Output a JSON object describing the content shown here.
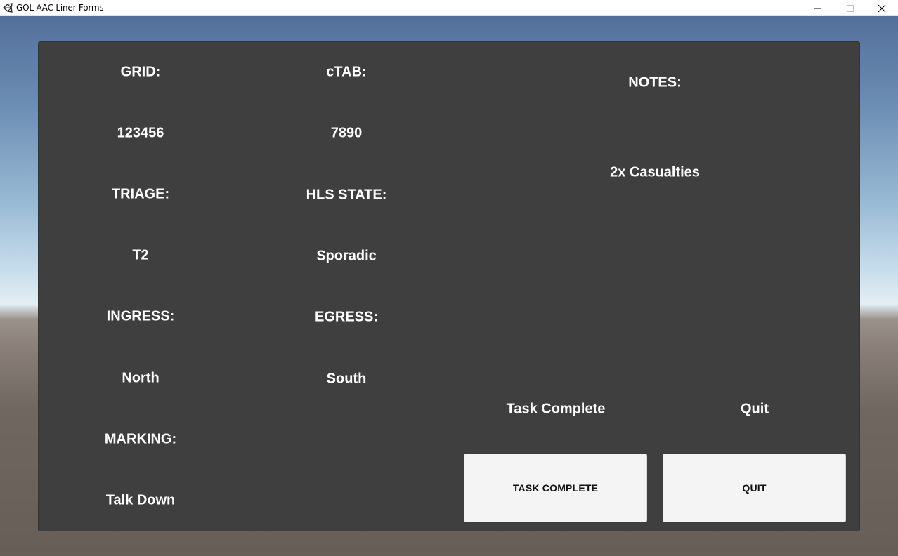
{
  "window": {
    "title": "GOL AAC Liner Forms",
    "icon": "unity-icon",
    "controls": {
      "minimize": "minimize-icon",
      "maximize": "maximize-icon",
      "close": "close-icon"
    }
  },
  "form": {
    "grid": {
      "label": "GRID:",
      "value": "123456"
    },
    "ctab": {
      "label": "cTAB:",
      "value": "7890"
    },
    "triage": {
      "label": "TRIAGE:",
      "value": "T2"
    },
    "hls_state": {
      "label": "HLS STATE:",
      "value": "Sporadic"
    },
    "ingress": {
      "label": "INGRESS:",
      "value": "North"
    },
    "egress": {
      "label": "EGRESS:",
      "value": "South"
    },
    "marking": {
      "label": "MARKING:",
      "value": "Talk Down"
    },
    "notes": {
      "label": "NOTES:",
      "value": "2x Casualties"
    }
  },
  "actions": {
    "task_complete": {
      "caption": "Task Complete",
      "button_label": "TASK COMPLETE"
    },
    "quit": {
      "caption": "Quit",
      "button_label": "QUIT"
    }
  },
  "colors": {
    "panel_bg": "#3f3f3f",
    "text": "#ffffff",
    "button_bg": "#f4f4f4",
    "button_text": "#111111"
  }
}
